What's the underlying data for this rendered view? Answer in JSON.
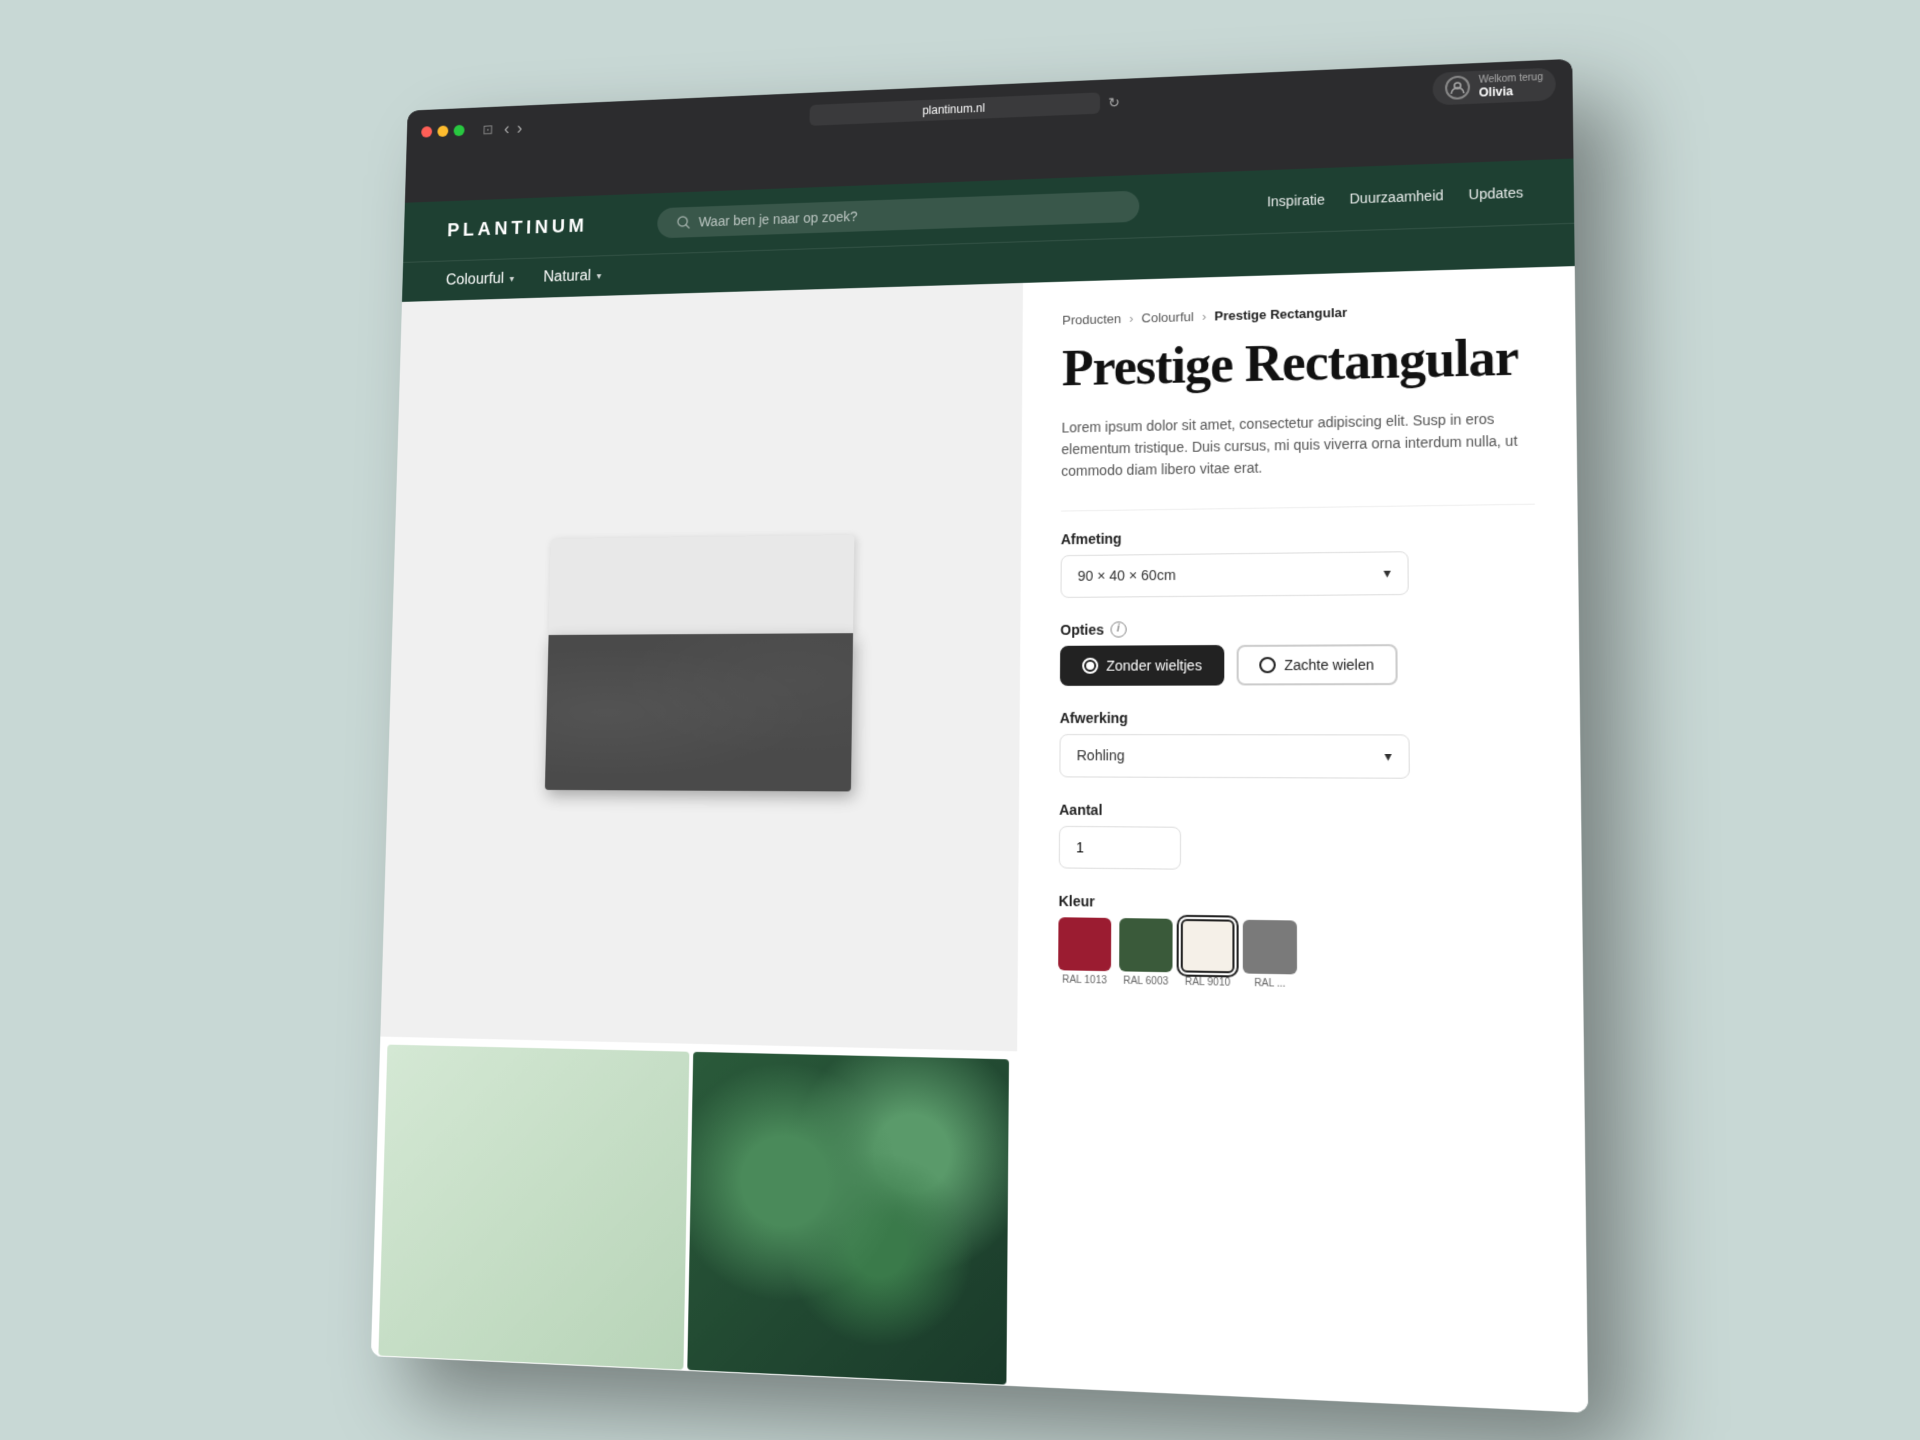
{
  "browser": {
    "url": "plantinum.nl",
    "reload_icon": "↻",
    "sidebar_icon": "⊡",
    "back_icon": "‹",
    "forward_icon": "›",
    "user_welcome": "Welkom terug",
    "user_name": "Olivia"
  },
  "site": {
    "logo": "PLANTINUM",
    "search_placeholder": "Waar ben je naar op zoek?",
    "nav_items": [
      {
        "label": "Inspiratie"
      },
      {
        "label": "Duurzaamheid"
      },
      {
        "label": "Updates"
      }
    ],
    "categories": [
      {
        "label": "Colourful",
        "has_dropdown": true
      },
      {
        "label": "Natural",
        "has_dropdown": true
      }
    ]
  },
  "breadcrumb": {
    "items": [
      "Producten",
      "Colourful"
    ],
    "current": "Prestige Rectangular"
  },
  "product": {
    "title": "Prestige Rectangular",
    "description": "Lorem ipsum dolor sit amet, consectetur adipiscing elit. Susp in eros elementum tristique. Duis cursus, mi quis viverra orna interdum nulla, ut commodo diam libero vitae erat.",
    "size_label": "Afmeting",
    "size_value": "90 × 40 × 60cm",
    "options_label": "Opties",
    "option_1": "Zonder wieltjes",
    "option_2": "Zachte wielen",
    "finishing_label": "Afwerking",
    "finishing_value": "Rohling",
    "quantity_label": "Aantal",
    "quantity_value": "1",
    "color_label": "Kleur",
    "colors": [
      {
        "code": "RAL 1013",
        "class": "swatch-ral-1013"
      },
      {
        "code": "RAL 6003",
        "class": "swatch-ral-6003"
      },
      {
        "code": "RAL 9010",
        "class": "swatch-ral-9010",
        "selected": true
      },
      {
        "code": "RAL ...",
        "class": "swatch-ral-gray"
      }
    ]
  }
}
